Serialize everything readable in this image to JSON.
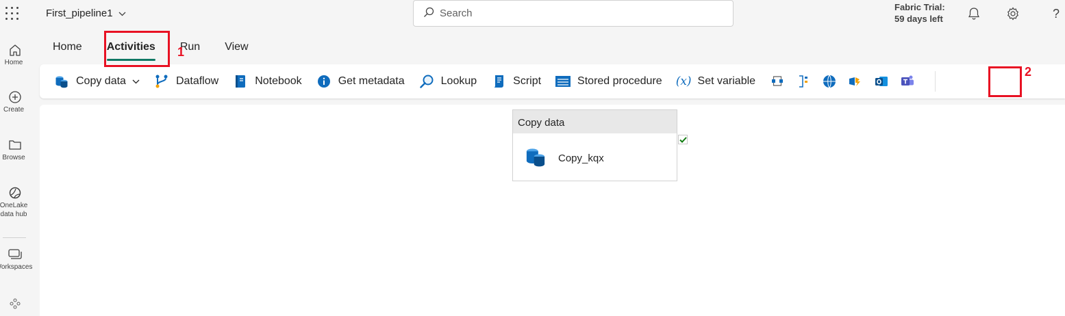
{
  "topbar": {
    "pipeline_name": "First_pipeline1",
    "search_placeholder": "Search",
    "trial_line1": "Fabric Trial:",
    "trial_line2": "59 days left",
    "help": "?"
  },
  "rail": {
    "items": [
      {
        "label": "Home",
        "icon": "home-icon"
      },
      {
        "label": "Create",
        "icon": "plus-circle-icon"
      },
      {
        "label": "Browse",
        "icon": "folder-icon"
      },
      {
        "label": "OneLake",
        "label2": "data hub",
        "icon": "onelake-icon"
      },
      {
        "label": "Workspaces",
        "icon": "workspaces-icon"
      }
    ]
  },
  "tabs": [
    "Home",
    "Activities",
    "Run",
    "View"
  ],
  "annotations": {
    "one": "1",
    "two": "2",
    "color": "#e81123"
  },
  "ribbon": {
    "copy_data": "Copy data",
    "dataflow": "Dataflow",
    "notebook": "Notebook",
    "get_metadata": "Get metadata",
    "lookup": "Lookup",
    "script": "Script",
    "stored_procedure": "Stored procedure",
    "set_variable": "Set variable",
    "set_variable_glyph": "(x)"
  },
  "canvas": {
    "activity_type": "Copy data",
    "activity_name": "Copy_kqx"
  },
  "colors": {
    "accent": "#117865",
    "copy_blue": "#0f6cbd"
  }
}
